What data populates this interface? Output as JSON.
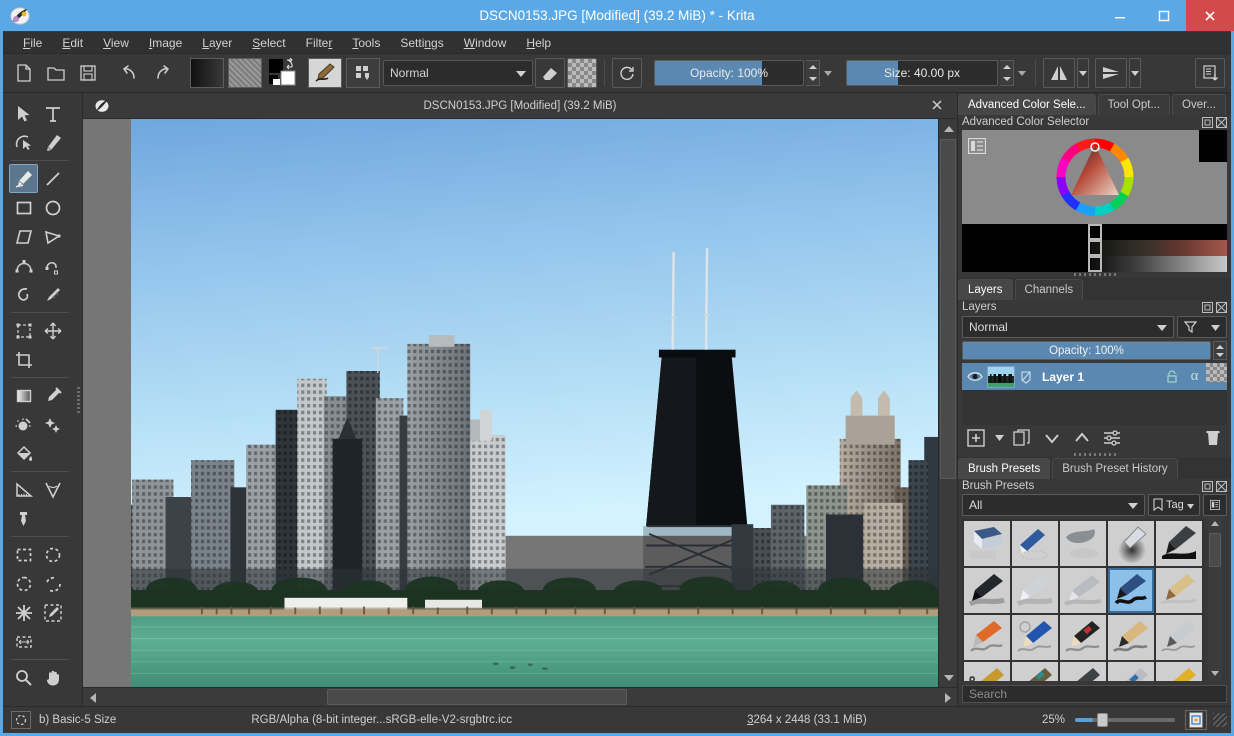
{
  "window": {
    "title": "DSCN0153.JPG [Modified]  (39.2 MiB) * - Krita",
    "app_icon": "krita-logo-icon",
    "minimize_label": "–",
    "maximize_label": "☐",
    "close_label": "✕",
    "accent_color": "#5aa9e6",
    "close_color": "#d44a4a"
  },
  "menubar": {
    "items": [
      {
        "label": "File",
        "accel": "F"
      },
      {
        "label": "Edit",
        "accel": "E"
      },
      {
        "label": "View",
        "accel": "V"
      },
      {
        "label": "Image",
        "accel": "I"
      },
      {
        "label": "Layer",
        "accel": "L"
      },
      {
        "label": "Select",
        "accel": "S"
      },
      {
        "label": "Filter",
        "accel": "r"
      },
      {
        "label": "Tools",
        "accel": "T"
      },
      {
        "label": "Settings",
        "accel": "n"
      },
      {
        "label": "Window",
        "accel": "W"
      },
      {
        "label": "Help",
        "accel": "H"
      }
    ]
  },
  "toolbar": {
    "new_label": "new-document",
    "open_label": "open-document",
    "save_label": "save-document",
    "undo_label": "undo",
    "redo_label": "redo",
    "gradient_label": "gradient-preview",
    "pattern_label": "pattern-preview",
    "fgbg_label": "foreground-background-colors",
    "brush_editor_label": "brush-editor",
    "workspace_label": "choose-workspace",
    "blend_mode": "Normal",
    "eraser_label": "eraser-toggle",
    "alpha_label": "preserve-alpha",
    "reset_label": "reload-preset",
    "opacity_label": "Opacity:",
    "opacity_value": "100%",
    "opacity_fill_pct": 72,
    "size_label": "Size:",
    "size_value": "40.00 px",
    "size_fill_pct": 34,
    "mirror_h_label": "mirror-horizontal",
    "mirror_v_label": "mirror-vertical",
    "show_assistants_label": "toolbar-overflow"
  },
  "toolbox": {
    "groups": [
      [
        "select-shapes-tool",
        "text-tool",
        "edit-shapes-tool",
        "calligraphy-tool"
      ],
      [
        "freehand-brush-tool",
        "line-tool",
        "rectangle-tool",
        "ellipse-tool",
        "polygon-tool",
        "polyline-tool",
        "bezier-curve-tool",
        "freehand-path-tool",
        "dynamic-brush-tool",
        "multibrush-tool"
      ],
      [
        "transform-tool",
        "move-tool",
        "crop-tool"
      ],
      [
        "gradient-tool",
        "color-sampler-tool",
        "colorize-mask-tool",
        "smart-patch-tool",
        "fill-tool"
      ],
      [
        "measure-tool",
        "angle-measure-tool",
        "assistant-tool"
      ],
      [
        "rectangular-selection-tool",
        "elliptical-selection-tool",
        "freehand-selection-tool",
        "polygonal-selection-tool",
        "contiguous-selection-tool",
        "similar-color-selection-tool",
        "bezier-selection-tool"
      ],
      [
        "zoom-tool",
        "pan-tool"
      ]
    ],
    "active_tool": "freehand-brush-tool"
  },
  "document": {
    "tab_title": "DSCN0153.JPG [Modified]  (39.2 MiB)",
    "close_label": "✕"
  },
  "dockers": {
    "top_tabs": [
      {
        "label": "Advanced Color Sele...",
        "active": true
      },
      {
        "label": "Tool Opt...",
        "active": false
      },
      {
        "label": "Over...",
        "active": false
      }
    ],
    "color_selector": {
      "title": "Advanced Color Selector",
      "float_label": "float-docker",
      "close_label": "close-docker"
    },
    "layer_tabs": [
      {
        "label": "Layers",
        "active": true
      },
      {
        "label": "Channels",
        "active": false
      }
    ],
    "layers_panel": {
      "title": "Layers",
      "blend_mode": "Normal",
      "filter_label": "filter-layers",
      "opacity_label": "Opacity:",
      "opacity_value": "100%",
      "layers": [
        {
          "name": "Layer 1",
          "visible": true,
          "locked": false,
          "alpha_icon": "alpha-lock-icon",
          "inherit_icon": "inherit-alpha-icon"
        }
      ],
      "buttons": [
        "add-layer-button",
        "add-layer-dropdown",
        "duplicate-layer-button",
        "move-layer-down-button",
        "move-layer-up-button",
        "layer-properties-button",
        "delete-layer-button"
      ]
    },
    "brush_tabs": [
      {
        "label": "Brush Presets",
        "active": true
      },
      {
        "label": "Brush Preset History",
        "active": false
      }
    ],
    "brush_panel": {
      "title": "Brush Presets",
      "tag_filter": "All",
      "tag_button": "Tag",
      "list_view_label": "toggle-list-view",
      "search_placeholder": "Search",
      "selected_index": 8,
      "presets": [
        "eraser-soft",
        "eraser-small",
        "eraser-circle",
        "airbrush-soft",
        "ink-brush-dark",
        "ink-pen-dark",
        "ink-gpen",
        "ink-ballpen",
        "basic-5-size",
        "bristles-wet",
        "marker-orange",
        "pencil-blue",
        "pencil-red",
        "pencil-wood",
        "pen-fine",
        "smudge-rake",
        "pencil-multi",
        "pen-tech",
        "pen-pressure",
        "nib-gold"
      ]
    }
  },
  "statusbar": {
    "selection_icon": "selection-mode-icon",
    "brush_preset": "b) Basic-5 Size",
    "color_space": "RGB/Alpha (8-bit integer...sRGB-elle-V2-srgbtrc.icc",
    "image_size": "3264 x 2448 (33.1 MiB)",
    "zoom_level": "25%",
    "fit_button": "fit-page-button"
  },
  "canvas": {
    "image_description": "Chicago skyline over Lake Michigan",
    "sky_top_color": "#6ea8dc",
    "sky_bottom_color": "#cdefff",
    "water_color": "#57a98c",
    "zoom_percent": 25
  }
}
